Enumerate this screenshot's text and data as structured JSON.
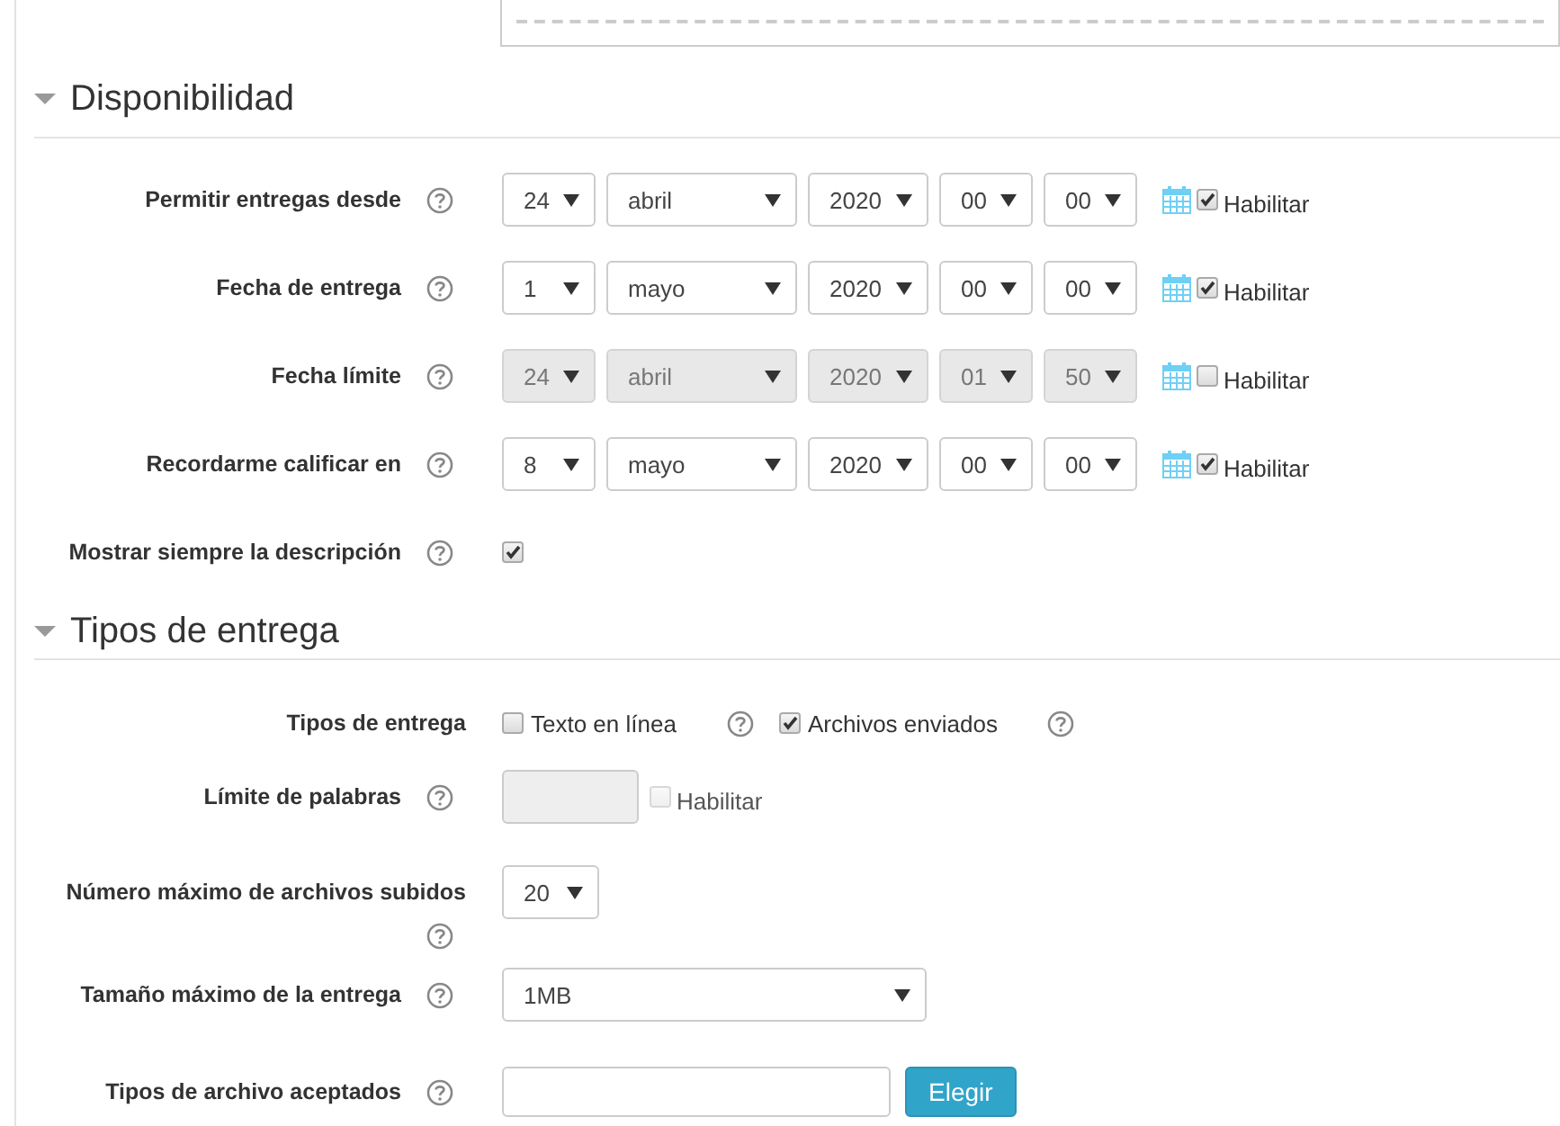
{
  "sections": [
    {
      "title": "Disponibilidad",
      "expanded": true,
      "fields": [
        {
          "kind": "datetime",
          "label": "Permitir entregas desde",
          "help": true,
          "disabled": false,
          "day": "24",
          "month": "abril",
          "year": "2020",
          "hour": "00",
          "minute": "00",
          "enable_label": "Habilitar",
          "enabled": true
        },
        {
          "kind": "datetime",
          "label": "Fecha de entrega",
          "help": true,
          "disabled": false,
          "day": "1",
          "month": "mayo",
          "year": "2020",
          "hour": "00",
          "minute": "00",
          "enable_label": "Habilitar",
          "enabled": true
        },
        {
          "kind": "datetime",
          "label": "Fecha límite",
          "help": true,
          "disabled": true,
          "day": "24",
          "month": "abril",
          "year": "2020",
          "hour": "01",
          "minute": "50",
          "enable_label": "Habilitar",
          "enabled": false
        },
        {
          "kind": "datetime",
          "label": "Recordarme calificar en",
          "help": true,
          "disabled": false,
          "day": "8",
          "month": "mayo",
          "year": "2020",
          "hour": "00",
          "minute": "00",
          "enable_label": "Habilitar",
          "enabled": true
        },
        {
          "kind": "checkbox",
          "label": "Mostrar siempre la descripción",
          "help": true,
          "checked": true
        }
      ]
    },
    {
      "title": "Tipos de entrega",
      "expanded": true,
      "fields": [
        {
          "kind": "options",
          "label": "Tipos de entrega",
          "help": false,
          "options": [
            {
              "label": "Texto en línea",
              "checked": false,
              "help": true
            },
            {
              "label": "Archivos enviados",
              "checked": true,
              "help": true
            }
          ]
        },
        {
          "kind": "number",
          "label": "Límite de palabras",
          "help": true,
          "disabled": true,
          "enable_label": "Habilitar",
          "enabled": false
        },
        {
          "kind": "short-select",
          "label": "Número máximo de archivos subidos",
          "help": true,
          "value": "20"
        },
        {
          "kind": "wide-select",
          "label": "Tamaño máximo de la entrega",
          "help": true,
          "value": "1MB"
        },
        {
          "kind": "filetypes",
          "label": "Tipos de archivo aceptados",
          "help": true,
          "button": "Elegir"
        }
      ]
    }
  ]
}
